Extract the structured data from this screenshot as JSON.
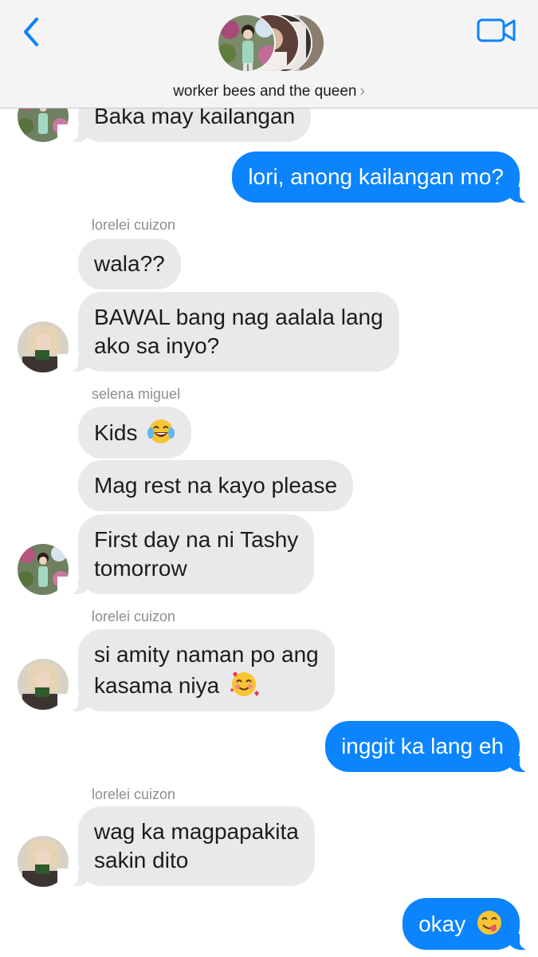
{
  "header": {
    "title": "worker bees and the queen",
    "chevron": "›",
    "back_icon": "chevron-left-icon",
    "video_icon": "video-camera-icon",
    "accent": "#0b84fe"
  },
  "colors": {
    "incoming_bubble": "#e9e9eb",
    "outgoing_bubble": "#0b84fe",
    "sender_label": "#8e8e93"
  },
  "messages": [
    {
      "from": "selena miguel",
      "text": "Baka may kailangan"
    },
    {
      "from": "me",
      "text": "lori, anong kailangan mo?"
    },
    {
      "sender_label": "lorelei cuizon"
    },
    {
      "from": "lorelei cuizon",
      "text": "wala??"
    },
    {
      "from": "lorelei cuizon",
      "line1": "BAWAL bang nag aalala lang",
      "line2": "ako sa inyo?"
    },
    {
      "sender_label": "selena miguel"
    },
    {
      "from": "selena miguel",
      "text": "Kids",
      "emoji": "face-with-tears-of-joy-emoji"
    },
    {
      "from": "selena miguel",
      "text": "Mag rest na kayo please"
    },
    {
      "from": "selena miguel",
      "line1": "First day na ni Tashy",
      "line2": "tomorrow"
    },
    {
      "sender_label": "lorelei cuizon"
    },
    {
      "from": "lorelei cuizon",
      "line1": "si amity naman po ang",
      "line2": "kasama niya",
      "emoji": "smiling-face-with-hearts-emoji"
    },
    {
      "from": "me",
      "text": "inggit ka lang eh"
    },
    {
      "sender_label": "lorelei cuizon"
    },
    {
      "from": "lorelei cuizon",
      "line1": "wag ka magpapakita",
      "line2": "sakin dito"
    },
    {
      "from": "me",
      "text": "okay",
      "emoji": "face-savoring-food-emoji"
    }
  ]
}
